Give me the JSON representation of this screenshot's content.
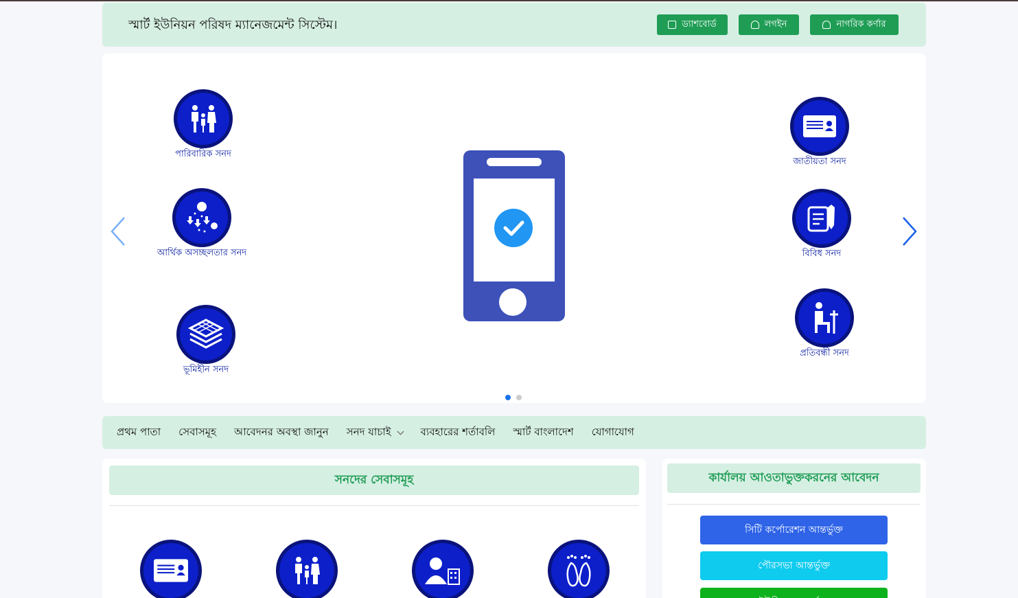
{
  "header": {
    "title": "স্মার্ট ইউনিয়ন পরিষদ ম্যানেজমেন্ট সিস্টেম।",
    "buttons": [
      {
        "label": "ড্যাশবোর্ড",
        "icon": "dashboard-icon"
      },
      {
        "label": "লগইন",
        "icon": "user-icon"
      },
      {
        "label": "নাগরিক কর্ণার",
        "icon": "users-icon"
      }
    ],
    "accent": "#1f9d55"
  },
  "slider": {
    "left_items": [
      "পারিবারিক সনদ",
      "আর্থিক অসচ্ছলতার সনদ",
      "ভূমিহীন সনদ"
    ],
    "right_items": [
      "জাতীয়তা সনদ",
      "বিবিধ সনদ",
      "প্রতিবন্ধী সনদ"
    ],
    "center_icon": "phone-check-icon",
    "slide_count": 2,
    "active_slide": 1
  },
  "nav": {
    "items": [
      "প্রথম পাতা",
      "সেবাসমূহ",
      "আবেদনর অবস্থা জানুন",
      "সনদ যাচাই",
      "ব্যবহারের শর্তাবলি",
      "স্মার্ট বাংলাদেশ",
      "যোগাযোগ"
    ]
  },
  "services": {
    "title": "সনদের সেবাসমূহ",
    "icons": [
      "id-card-icon",
      "family-icon",
      "person-building-icon",
      "footprint-icon"
    ]
  },
  "office": {
    "title": "কার্যালয় আওতাভুক্তকরনের আবেদন",
    "buttons": [
      {
        "label": "সিটি কর্পোরেশন আন্তর্ভুক্ত",
        "color": "#2f64e8"
      },
      {
        "label": "পৌরসভা আন্তর্ভুক্ত",
        "color": "#0fcbee"
      },
      {
        "label": "ইউনিয়ন আন্তর্ভুক্ত",
        "color": "#0eb21c"
      }
    ]
  },
  "colors": {
    "icon_blue": "#0c1fc9",
    "brand_green": "#1f9d55",
    "header_bg": "#d6efe3"
  }
}
